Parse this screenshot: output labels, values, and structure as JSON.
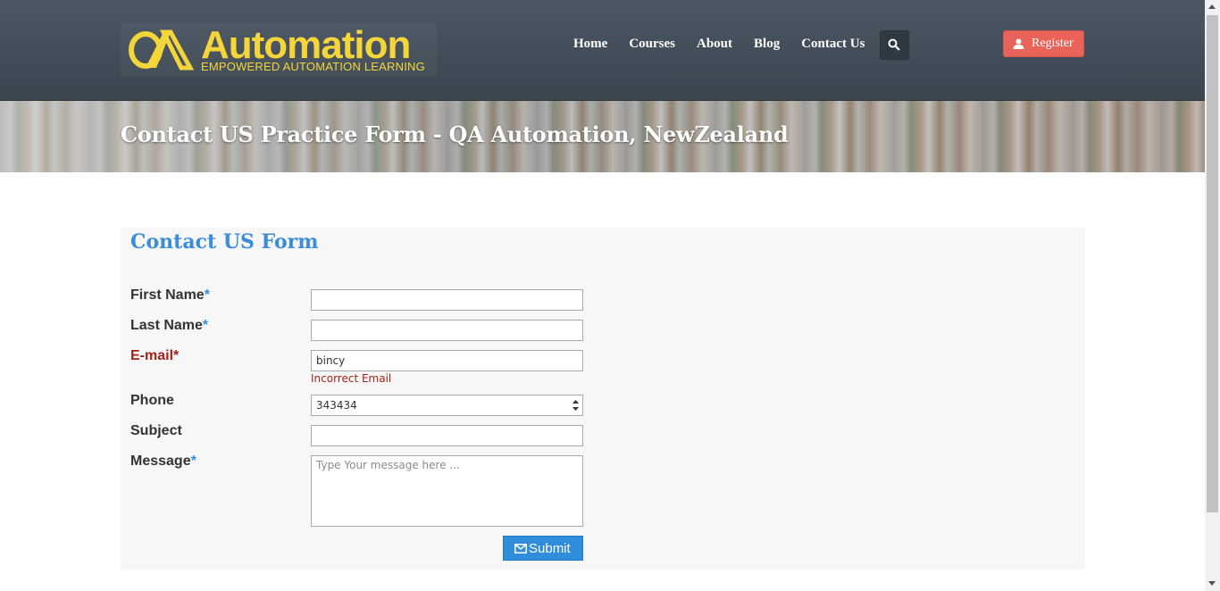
{
  "header": {
    "logo": {
      "title": "Automation",
      "subtitle": "EMPOWERED AUTOMATION LEARNING",
      "icon": "qa-logo-icon"
    },
    "nav": [
      "Home",
      "Courses",
      "About",
      "Blog",
      "Contact Us"
    ],
    "search_icon": "search-icon",
    "register_label": "Register",
    "register_icon": "user-icon"
  },
  "banner": {
    "title": "Contact US Practice Form - QA Automation, NewZealand"
  },
  "form": {
    "title": "Contact US Form",
    "required_mark": "*",
    "first_name": {
      "label": "First Name",
      "value": ""
    },
    "last_name": {
      "label": "Last Name",
      "value": ""
    },
    "email": {
      "label": "E-mail",
      "value": "bincy",
      "error": "Incorrect Email"
    },
    "phone": {
      "label": "Phone",
      "value": "343434"
    },
    "subject": {
      "label": "Subject",
      "value": ""
    },
    "message": {
      "label": "Message",
      "placeholder": "Type Your message here ..."
    },
    "submit_label": "Submit",
    "submit_icon": "envelope-icon"
  },
  "colors": {
    "accent": "#3a8dd8",
    "error": "#a3231b",
    "register": "#e8645a",
    "logo": "#f5d63a",
    "header": "#44505b"
  }
}
